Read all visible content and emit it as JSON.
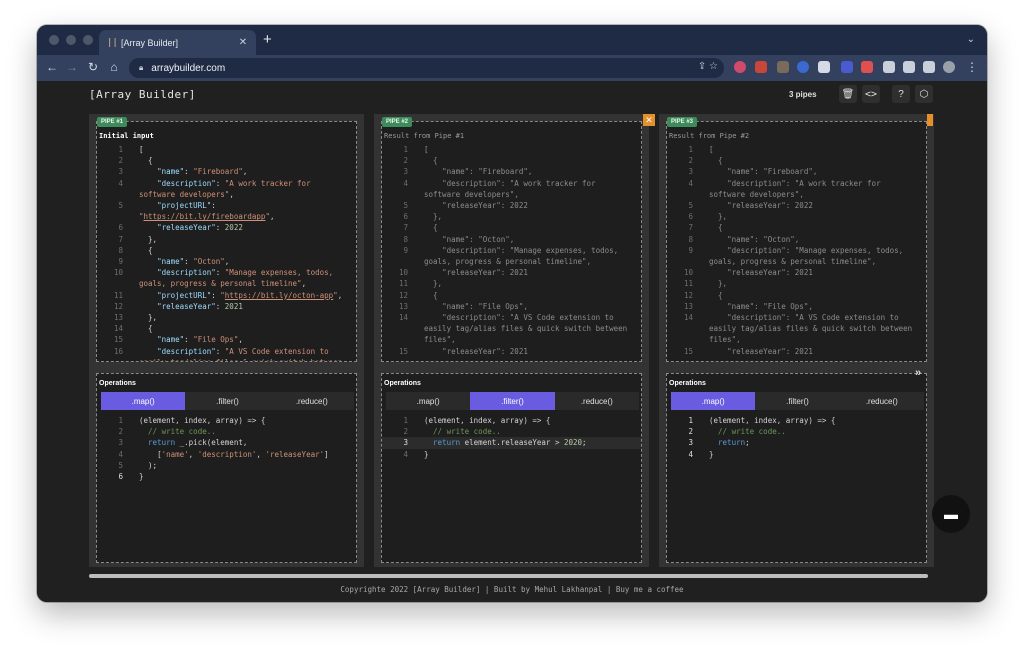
{
  "browser": {
    "tab_title": "[Array Builder]",
    "tab_icon": "||",
    "url": "arraybuilder.com"
  },
  "app": {
    "title": "[Array Builder]",
    "pipes_count": "3 pipes"
  },
  "pipes": [
    {
      "badge": "PIPE #1",
      "input_label": "Initial input",
      "operations_label": "Operations",
      "tabs": [
        ".map()",
        ".filter()",
        ".reduce()"
      ],
      "active_tab": ".map()"
    },
    {
      "badge": "PIPE #2",
      "input_label": "Result from Pipe #1",
      "operations_label": "Operations",
      "tabs": [
        ".map()",
        ".filter()",
        ".reduce()"
      ],
      "active_tab": ".filter()"
    },
    {
      "badge": "PIPE #3",
      "input_label": "Result from Pipe #2",
      "operations_label": "Operations",
      "tabs": [
        ".map()",
        ".filter()",
        ".reduce()"
      ],
      "active_tab": ".map()"
    }
  ],
  "footer": "Copyrighte 2022 [Array Builder] | Built by Mehul Lakhanpal | Buy me a coffee",
  "colors": {
    "accent": "#6a5ce0",
    "badge": "#3d8b5a",
    "close": "#e5902b"
  }
}
